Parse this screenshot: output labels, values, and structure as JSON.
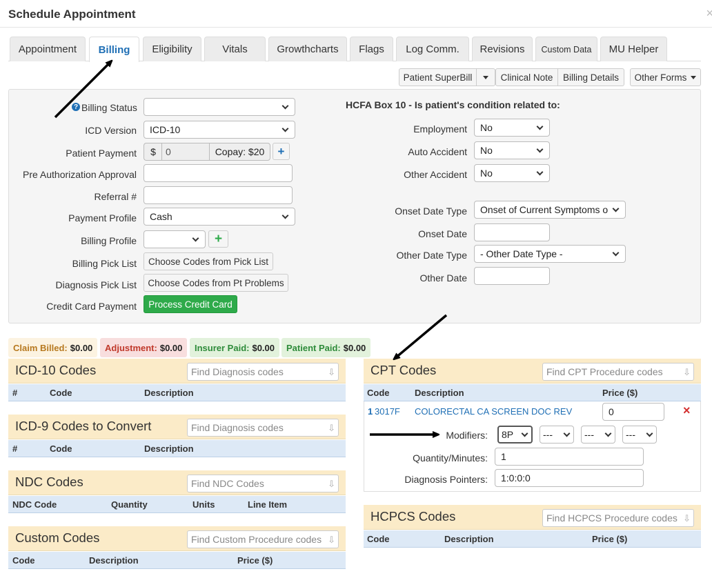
{
  "window": {
    "title": "Schedule Appointment",
    "close_glyph": "×"
  },
  "tabs": [
    {
      "label": "Appointment"
    },
    {
      "label": "Billing"
    },
    {
      "label": "Eligibility"
    },
    {
      "label": "Vitals"
    },
    {
      "label": "Growthcharts"
    },
    {
      "label": "Flags"
    },
    {
      "label": "Log Comm."
    },
    {
      "label": "Revisions"
    },
    {
      "label": "Custom Data"
    },
    {
      "label": "MU Helper"
    }
  ],
  "toolbar": {
    "superbill": "Patient SuperBill",
    "clinical_note": "Clinical Note",
    "billing_details": "Billing Details",
    "other_forms": "Other Forms"
  },
  "form": {
    "billing_status": {
      "label": "Billing Status",
      "value": "",
      "help_icon": "?"
    },
    "icd_version": {
      "label": "ICD Version",
      "value": "ICD-10"
    },
    "patient_payment": {
      "label": "Patient Payment",
      "currency": "$",
      "value": "0",
      "copay": "Copay: $20",
      "add": "+"
    },
    "pre_auth": {
      "label": "Pre Authorization Approval",
      "value": ""
    },
    "referral": {
      "label": "Referral #",
      "value": ""
    },
    "payment_profile": {
      "label": "Payment Profile",
      "value": "Cash"
    },
    "billing_profile": {
      "label": "Billing Profile",
      "value": "",
      "add": "+"
    },
    "billing_pick_list": {
      "label": "Billing Pick List",
      "button": "Choose Codes from Pick List"
    },
    "diagnosis_pick_list": {
      "label": "Diagnosis Pick List",
      "button": "Choose Codes from Pt Problems"
    },
    "credit_card": {
      "label": "Credit Card Payment",
      "button": "Process Credit Card"
    }
  },
  "hcfa": {
    "heading": "HCFA Box 10 - Is patient's condition related to:",
    "employment": {
      "label": "Employment",
      "value": "No"
    },
    "auto_accident": {
      "label": "Auto Accident",
      "value": "No"
    },
    "other_accident": {
      "label": "Other Accident",
      "value": "No"
    },
    "onset_date_type": {
      "label": "Onset Date Type",
      "value": "Onset of Current Symptoms o"
    },
    "onset_date": {
      "label": "Onset Date",
      "value": ""
    },
    "other_date_type": {
      "label": "Other Date Type",
      "value": "- Other Date Type -"
    },
    "other_date": {
      "label": "Other Date",
      "value": ""
    }
  },
  "summary": {
    "claim_billed": {
      "label": "Claim Billed:",
      "value": "$0.00",
      "color": "#b7791f",
      "bg": "#fcf3e1"
    },
    "adjustment": {
      "label": "Adjustment:",
      "value": "$0.00",
      "color": "#c0392b",
      "bg": "#f8dede"
    },
    "insurer_paid": {
      "label": "Insurer Paid:",
      "value": "$0.00",
      "color": "#2e8b3a",
      "bg": "#e2f2dc"
    },
    "patient_paid": {
      "label": "Patient Paid:",
      "value": "$0.00",
      "color": "#2e8b3a",
      "bg": "#e2f2dc"
    }
  },
  "icd10": {
    "title": "ICD-10 Codes",
    "search": "Find Diagnosis codes",
    "cols": [
      "#",
      "Code",
      "Description"
    ]
  },
  "icd9": {
    "title": "ICD-9 Codes to Convert",
    "search": "Find Diagnosis codes",
    "cols": [
      "#",
      "Code",
      "Description"
    ]
  },
  "ndc": {
    "title": "NDC Codes",
    "search": "Find NDC Codes",
    "cols": [
      "NDC Code",
      "Quantity",
      "Units",
      "Line Item"
    ]
  },
  "custom": {
    "title": "Custom Codes",
    "search": "Find Custom Procedure codes",
    "cols": [
      "Code",
      "Description",
      "Price ($)"
    ]
  },
  "cpt": {
    "title": "CPT Codes",
    "search": "Find CPT Procedure codes",
    "cols": [
      "Code",
      "Description",
      "Price ($)"
    ],
    "row": {
      "num": "1",
      "code": "3017F",
      "description": "COLORECTAL CA SCREEN DOC REV",
      "price": "0",
      "remove": "×"
    },
    "modifiers": {
      "label": "Modifiers:",
      "values": [
        "8P",
        "---",
        "---",
        "---"
      ]
    },
    "quantity": {
      "label": "Quantity/Minutes:",
      "value": "1"
    },
    "pointers": {
      "label": "Diagnosis Pointers:",
      "value": "1:0:0:0"
    }
  },
  "hcpcs": {
    "title": "HCPCS Codes",
    "search": "Find HCPCS Procedure codes",
    "cols": [
      "Code",
      "Description",
      "Price ($)"
    ]
  }
}
